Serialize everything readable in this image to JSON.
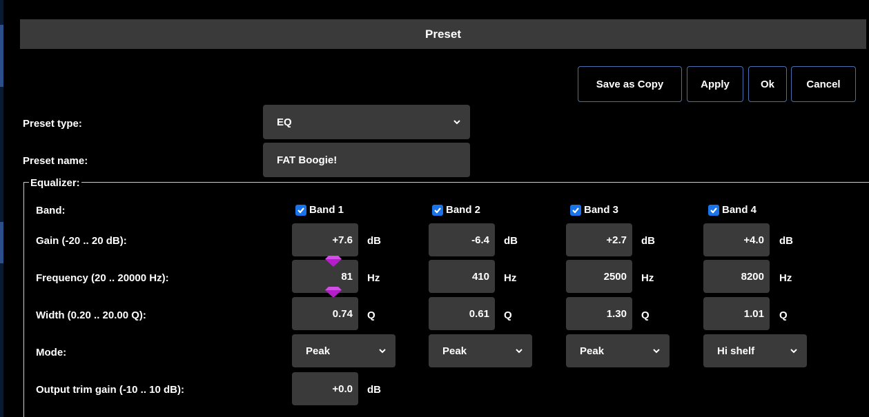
{
  "dialog": {
    "title": "Preset"
  },
  "toolbar": {
    "save_as_copy": "Save as Copy",
    "apply": "Apply",
    "ok": "Ok",
    "cancel": "Cancel"
  },
  "form": {
    "preset_type_label": "Preset type:",
    "preset_type_value": "EQ",
    "preset_name_label": "Preset name:",
    "preset_name_value": "FAT Boogie!"
  },
  "equalizer": {
    "legend": "Equalizer:",
    "row_labels": {
      "band": "Band:",
      "gain": "Gain (-20 .. 20 dB):",
      "frequency": "Frequency (20 .. 20000 Hz):",
      "width": "Width (0.20 .. 20.00 Q):",
      "mode": "Mode:",
      "output_trim": "Output trim gain (-10 .. 10 dB):"
    },
    "units": {
      "gain": "dB",
      "frequency": "Hz",
      "width": "Q",
      "trim": "dB"
    },
    "bands": [
      {
        "label": "Band 1",
        "enabled": true,
        "gain": "+7.6",
        "frequency": "81",
        "width": "0.74",
        "mode": "Peak"
      },
      {
        "label": "Band 2",
        "enabled": true,
        "gain": "-6.4",
        "frequency": "410",
        "width": "0.61",
        "mode": "Peak"
      },
      {
        "label": "Band 3",
        "enabled": true,
        "gain": "+2.7",
        "frequency": "2500",
        "width": "1.30",
        "mode": "Peak"
      },
      {
        "label": "Band 4",
        "enabled": true,
        "gain": "+4.0",
        "frequency": "8200",
        "width": "1.01",
        "mode": "Hi shelf"
      }
    ],
    "output_trim_value": "+0.0"
  },
  "colors": {
    "accent_border": "#4a6fb0",
    "field_bg": "#3a3a3a",
    "checkbox": "#1a73e8",
    "spinner_marker": "#b41ec8"
  },
  "icons": {
    "select_arrow": "chevron-down-icon",
    "checkbox_check": "check-icon",
    "spinner": "diamond-marker-icon"
  }
}
